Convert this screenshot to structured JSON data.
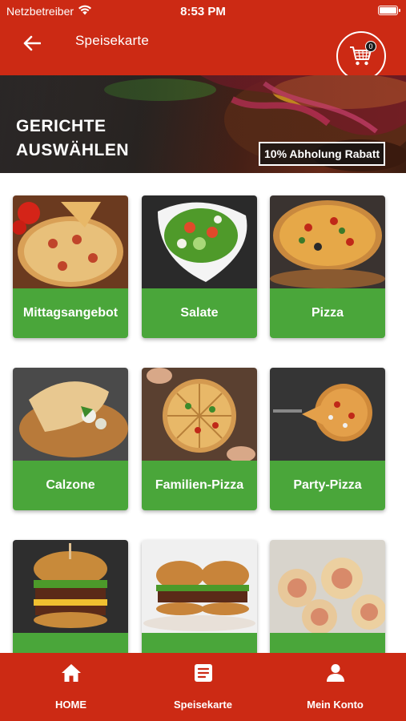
{
  "status_bar": {
    "carrier": "Netzbetreiber",
    "time": "8:53 PM"
  },
  "header": {
    "title": "Speisekarte",
    "cart_count": "0"
  },
  "banner": {
    "headline": "GERICHTE\nAUSWÄHLEN",
    "badge": "10% Abholung Rabatt"
  },
  "categories": [
    {
      "label": "Mittagsangebot",
      "image": "pizza-on-board-photo"
    },
    {
      "label": "Salate",
      "image": "salad-bowl-photo"
    },
    {
      "label": "Pizza",
      "image": "pizza-photo"
    },
    {
      "label": "Calzone",
      "image": "calzone-photo"
    },
    {
      "label": "Familien-Pizza",
      "image": "family-pizza-photo"
    },
    {
      "label": "Party-Pizza",
      "image": "party-pizza-photo"
    },
    {
      "label": "",
      "image": "burger-photo"
    },
    {
      "label": "",
      "image": "burgers-plate-photo"
    },
    {
      "label": "",
      "image": "pizza-rolls-photo"
    }
  ],
  "bottom_nav": [
    {
      "label": "HOME",
      "icon": "home-icon"
    },
    {
      "label": "Speisekarte",
      "icon": "menu-list-icon"
    },
    {
      "label": "Mein Konto",
      "icon": "user-icon"
    }
  ],
  "colors": {
    "brand_red": "#cc2a14",
    "category_green": "#4aa63a"
  }
}
